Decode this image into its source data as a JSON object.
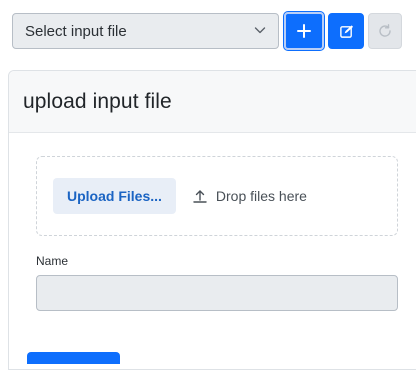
{
  "toolbar": {
    "select_value": "Select input file",
    "add_icon": "plus-icon",
    "edit_icon": "edit-icon",
    "refresh_icon": "refresh-icon"
  },
  "card": {
    "title": "upload input file",
    "upload_button_label": "Upload Files...",
    "upload_icon": "upload-icon",
    "drop_hint": "Drop files here",
    "name_label": "Name",
    "name_value": ""
  },
  "colors": {
    "primary": "#0d6efd",
    "link_text": "#1b64c3",
    "input_bg": "#e9ecef",
    "disabled_bg": "#e3e6ea"
  }
}
